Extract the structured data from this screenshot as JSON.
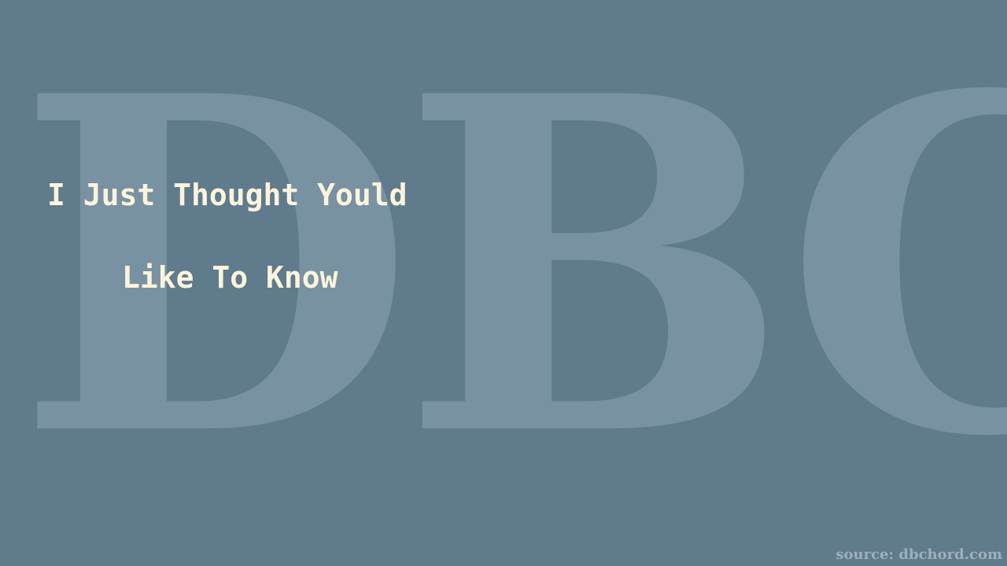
{
  "watermark": {
    "text": "DBC"
  },
  "title": {
    "line1": "I Just Thought Yould",
    "line2": "Like To Know"
  },
  "source": {
    "text": "source: dbchord.com"
  },
  "colors": {
    "background": "#5f7b8c",
    "title_text": "#fbf3dc",
    "watermark": "#a9bcc8",
    "source_text": "#9db0bc"
  }
}
